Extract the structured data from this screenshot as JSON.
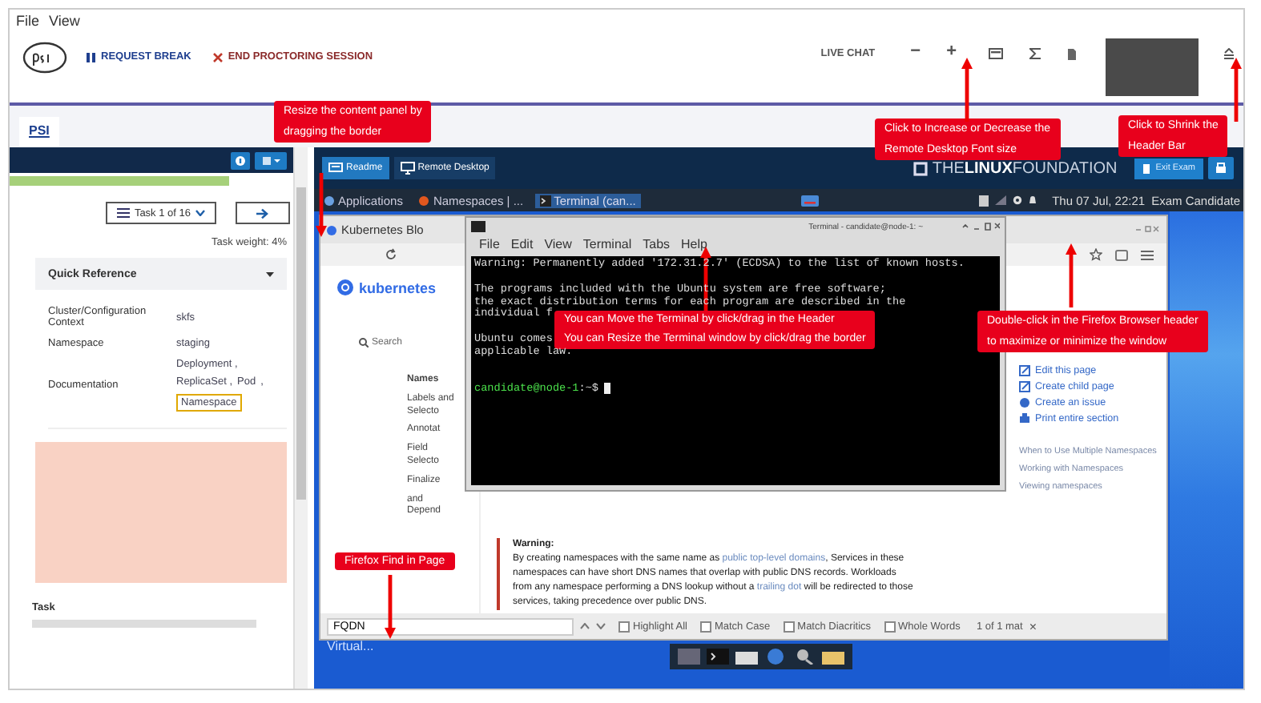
{
  "menu_bar": [
    "File",
    "View"
  ],
  "header": {
    "actions": [
      {
        "kind": "break",
        "label": "REQUEST BREAK"
      },
      {
        "kind": "end",
        "label": "END PROCTORING SESSION"
      }
    ],
    "live_chat": "LIVE CHAT",
    "font_buttons": [
      "−",
      "+"
    ]
  },
  "tab": {
    "label": "PSI",
    "selected": true
  },
  "left_panel": {
    "task_selector": "Task 1 of 16",
    "task_weight": "Task weight: 4%",
    "quick_reference": {
      "title": "Quick Reference",
      "expanded": true,
      "rows": [
        {
          "label": "Cluster/Configuration Context",
          "values": [
            {
              "text": "skfs",
              "highlighted": false
            }
          ]
        },
        {
          "label": "Namespace",
          "values": [
            {
              "text": "staging",
              "highlighted": false
            }
          ]
        },
        {
          "label": "Documentation",
          "values": [
            {
              "text": "Deployment ,",
              "highlighted": false
            },
            {
              "text": "ReplicaSet ,",
              "highlighted": false
            },
            {
              "text": "Pod",
              "highlighted": false
            },
            {
              "text": ",",
              "highlighted": false
            },
            {
              "text": "Namespace",
              "highlighted": true
            }
          ]
        }
      ]
    },
    "task_heading": "Task"
  },
  "remote": {
    "buttons": [
      {
        "kind": "readme",
        "label": "Readme",
        "selected": true
      },
      {
        "kind": "desktop",
        "label": "Remote Desktop",
        "selected": false
      }
    ],
    "logo": "THE**LINUX**FOUNDATION",
    "exit_button": "Exit Exam",
    "panel": {
      "items": [
        "Applications",
        "Namespaces | ...",
        "Terminal (can..."
      ],
      "clock": "Thu 07 Jul, 22:21",
      "user": "Exam Candidate"
    },
    "firefox": {
      "tab_title": "Kubernetes Blo",
      "brand": "kubernetes",
      "search": "Search",
      "nav": [
        "Names",
        "Labels and Selecto",
        "Annotat",
        "Field Selecto",
        "Finalize",
        "and Depend"
      ],
      "links": [
        "Edit this page",
        "Create child page",
        "Create an issue",
        "Print entire section"
      ],
      "toc": [
        "When to Use Multiple Namespaces",
        "Working with Namespaces",
        "Viewing namespaces"
      ],
      "warning_title": "Warning:",
      "warning": [
        {
          "kind": "text",
          "text": "By creating namespaces with the same name as "
        },
        {
          "kind": "link",
          "text": "public top-level domains"
        },
        {
          "kind": "text",
          "text": ", Services in these namespaces can have short DNS names that overlap with public DNS records. Workloads from any namespace performing a DNS lookup without a "
        },
        {
          "kind": "link",
          "text": "trailing dot"
        },
        {
          "kind": "text",
          "text": " will be redirected to those services, taking precedence over public DNS."
        }
      ],
      "find": {
        "value": "FQDN",
        "options": [
          {
            "label": "Highlight All",
            "checked": false
          },
          {
            "label": "Match Case",
            "checked": false
          },
          {
            "label": "Match Diacritics",
            "checked": false
          },
          {
            "label": "Whole Words",
            "checked": false
          }
        ],
        "result": "1 of 1 mat",
        "close": "×"
      }
    },
    "terminal": {
      "title": "Terminal - candidate@node-1: ~",
      "menus": [
        "File",
        "Edit",
        "View",
        "Terminal",
        "Tabs",
        "Help"
      ],
      "blocks": [
        [
          "Warning: Permanently added '172.31.2.7' (ECDSA) to the list of known hosts."
        ],
        [
          "The programs included with the Ubuntu system are free software;",
          "the exact distribution terms for each program are described in the",
          "individual f"
        ],
        [
          "Ubuntu comes",
          "applicable law."
        ]
      ],
      "prompt_user": "candidate@node-1",
      "prompt_suffix": ":~$"
    },
    "desktop_label": "Virtual..."
  },
  "callouts": [
    {
      "kind": "panel",
      "lines": [
        "Resize the content panel by",
        "dragging the border"
      ]
    },
    {
      "kind": "font",
      "lines": [
        "Click to Increase or Decrease the",
        "Remote Desktop Font size"
      ]
    },
    {
      "kind": "shrink",
      "lines": [
        "Click to Shrink the",
        "Header Bar"
      ]
    },
    {
      "kind": "terminal",
      "lines": [
        "You can Move the Terminal by click/drag in the Header",
        "You can Resize the Terminal window by click/drag the border"
      ]
    },
    {
      "kind": "firefox",
      "lines": [
        "Double-click in the Firefox Browser header",
        "to maximize or minimize the window"
      ]
    },
    {
      "kind": "find",
      "lines": [
        "Firefox Find in Page"
      ]
    }
  ]
}
